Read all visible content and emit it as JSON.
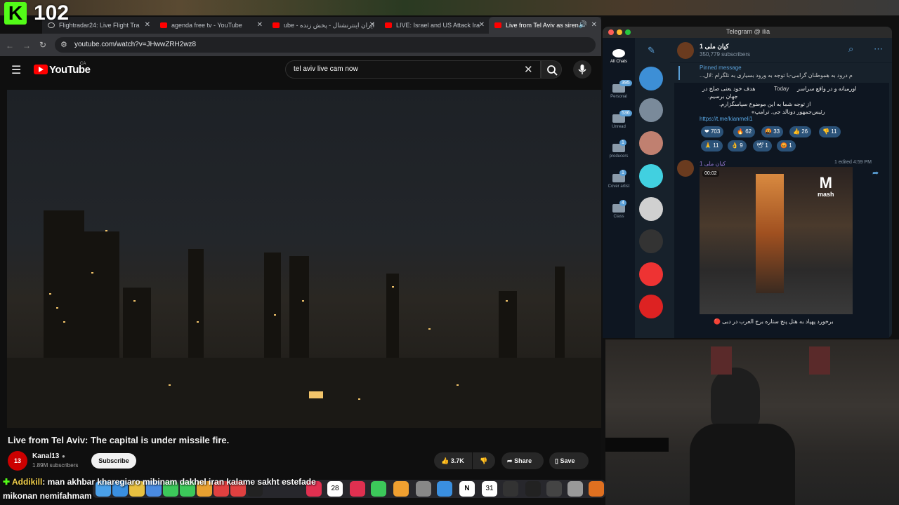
{
  "overlay": {
    "logo": "K",
    "viewer_count": "102"
  },
  "browser": {
    "tabs": [
      {
        "title": "Flightradar24: Live Flight Tra",
        "icon": "globe-icon"
      },
      {
        "title": "agenda free tv - YouTube",
        "icon": "youtube-icon"
      },
      {
        "title": "ube - ایران اینترنشنال - پخش زنده",
        "icon": "youtube-icon"
      },
      {
        "title": "LIVE: Israel and US Attack Ira",
        "icon": "youtube-icon"
      },
      {
        "title": "Live from Tel Aviv as siren",
        "icon": "youtube-icon",
        "active": true
      }
    ],
    "url": "youtube.com/watch?v=JHwwZRH2wz8"
  },
  "youtube": {
    "logo_text": "YouTube",
    "region": "CA",
    "search_value": "tel aviv live cam now",
    "video_title": "Live from Tel Aviv: The capital is under missile fire.",
    "channel": {
      "name": "Kanal13",
      "avatar_text": "13",
      "subscribers": "1.89M subscribers"
    },
    "subscribe_label": "Subscribe",
    "actions": {
      "likes": "3.7K",
      "share": "Share",
      "save": "Save"
    }
  },
  "telegram": {
    "window_title": "Telegram @ ilia",
    "folders": [
      {
        "label": "All Chats",
        "badge": ""
      },
      {
        "label": "Personal",
        "badge": "395"
      },
      {
        "label": "Unread",
        "badge": "536"
      },
      {
        "label": "producers",
        "badge": "1"
      },
      {
        "label": "Cover artist",
        "badge": "1"
      },
      {
        "label": "Class",
        "badge": "4"
      }
    ],
    "chat_badges": [
      "1",
      "12",
      "",
      "",
      "",
      "55",
      "5",
      ""
    ],
    "channel_name": "کیان ملی 1",
    "channel_subscribers": "350,779 subscribers",
    "pinned_label": "Pinned message",
    "pinned_text": "م درود به هموطنان گرامی-با توجه به ورود بسیاری به تلگرام :لال...",
    "message_lines": [
      "هدف خود یعنی صلح در",
      "جهان برسیم.",
      "از توجه شما به این موضوع سپاسگزارم.",
      "رئیس‌جمهور دونالد جی. ترامپ»"
    ],
    "message_time_label": "Today",
    "message_inline": "اورمیانه و در واقع سراسر",
    "link": "https://t.me/kianmeli1",
    "reactions": [
      {
        "emoji": "❤",
        "count": "703"
      },
      {
        "emoji": "🔥",
        "count": "62"
      },
      {
        "emoji": "🤬",
        "count": "33"
      },
      {
        "emoji": "👍",
        "count": "26"
      },
      {
        "emoji": "👎",
        "count": "11"
      },
      {
        "emoji": "🙏",
        "count": "11"
      },
      {
        "emoji": "👌",
        "count": "9"
      },
      {
        "emoji": "🕊",
        "count": "1"
      },
      {
        "emoji": "😡",
        "count": "1"
      }
    ],
    "post_author": "کیان ملی 1",
    "post_meta": "1 edited 4:59 PM",
    "media_duration": "00:02",
    "media_watermark": "mash",
    "caption": "برخورد پهپاد به هتل پنج ستاره برج العرب در دبی 🔴"
  },
  "chat": {
    "username": "Addikill",
    "line1": ": man akhbar kharegiaro mibinam dakhel iran kalame sakht estefade",
    "line2": "mikonan nemifahmam"
  },
  "dock": {
    "calendar_day": "28",
    "calendar2_day": "31",
    "apps": [
      "finder-icon",
      "safari-icon",
      "chrome-icon",
      "mail-icon",
      "messages-icon",
      "facetime-icon",
      "photos-icon",
      "appletv-icon",
      "music-icon",
      "calendar-icon",
      "news-icon",
      "numbers-icon",
      "pages-icon",
      "settings-icon",
      "appstore-icon",
      "notion-icon",
      "fantastical-icon",
      "camera-icon",
      "obs-icon",
      "unity-icon",
      "disk-icon",
      "logic-icon"
    ]
  }
}
